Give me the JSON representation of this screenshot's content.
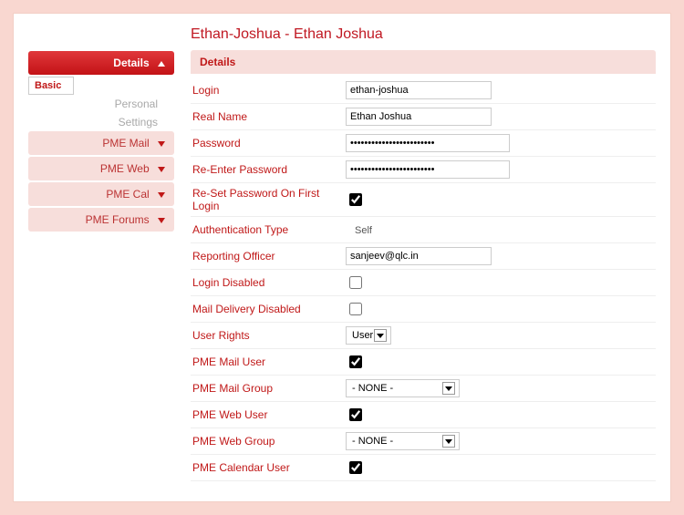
{
  "title": "Ethan-Joshua - Ethan Joshua",
  "section_header": "Details",
  "sidebar": {
    "details": "Details",
    "basic": "Basic",
    "personal": "Personal",
    "settings": "Settings",
    "pme_mail": "PME Mail",
    "pme_web": "PME Web",
    "pme_cal": "PME Cal",
    "pme_forums": "PME Forums"
  },
  "form": {
    "login": {
      "label": "Login",
      "value": "ethan-joshua"
    },
    "real_name": {
      "label": "Real Name",
      "value": "Ethan Joshua"
    },
    "password": {
      "label": "Password",
      "value": "••••••••••••••••••••••••"
    },
    "repassword": {
      "label": "Re-Enter Password",
      "value": "••••••••••••••••••••••••"
    },
    "reset_first": {
      "label": "Re-Set Password On First Login",
      "checked": true
    },
    "auth_type": {
      "label": "Authentication Type",
      "value": "Self"
    },
    "reporting_officer": {
      "label": "Reporting Officer",
      "value": "sanjeev@qlc.in"
    },
    "login_disabled": {
      "label": "Login Disabled",
      "checked": false
    },
    "mail_delivery_disabled": {
      "label": "Mail Delivery Disabled",
      "checked": false
    },
    "user_rights": {
      "label": "User Rights",
      "value": "User"
    },
    "pme_mail_user": {
      "label": "PME Mail User",
      "checked": true
    },
    "pme_mail_group": {
      "label": "PME Mail Group",
      "value": "- NONE -"
    },
    "pme_web_user": {
      "label": "PME Web User",
      "checked": true
    },
    "pme_web_group": {
      "label": "PME Web Group",
      "value": "- NONE -"
    },
    "pme_calendar_user": {
      "label": "PME Calendar User",
      "checked": true
    }
  }
}
